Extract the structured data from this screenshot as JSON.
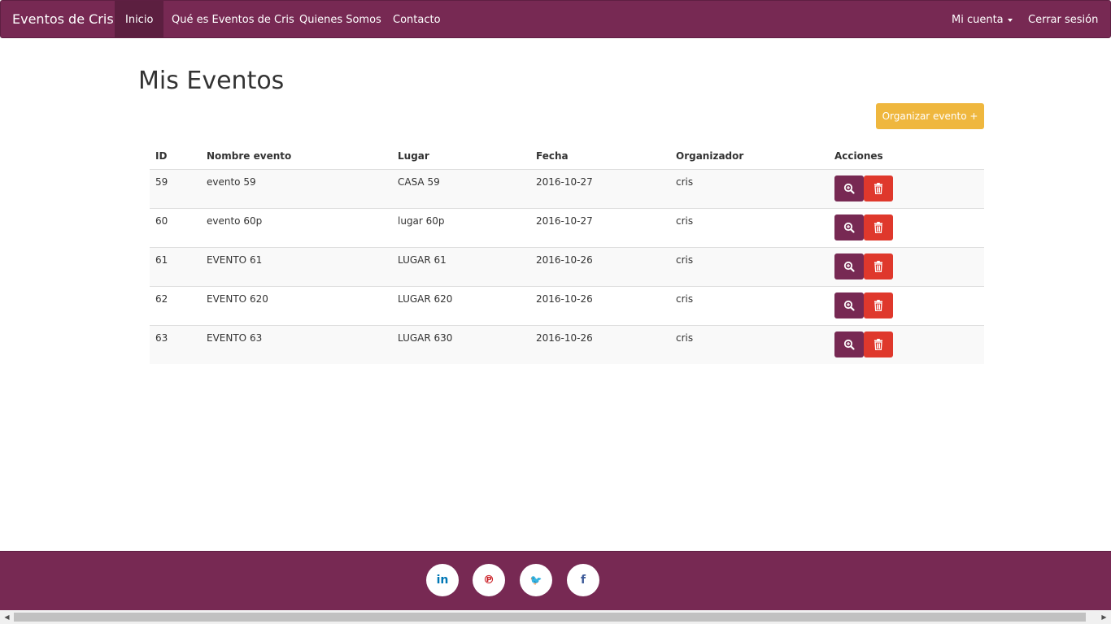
{
  "navbar": {
    "brand": "Eventos de Cris",
    "items": [
      {
        "label": "Inicio",
        "active": true
      },
      {
        "label": "Qué es Eventos de Cris"
      },
      {
        "label": "Quienes Somos"
      },
      {
        "label": "Contacto"
      }
    ],
    "account_label": "Mi cuenta",
    "logout_label": "Cerrar sesión"
  },
  "page": {
    "title": "Mis Eventos",
    "organize_button": "Organizar evento +"
  },
  "table": {
    "headers": [
      "ID",
      "Nombre evento",
      "Lugar",
      "Fecha",
      "Organizador",
      "Acciones"
    ],
    "rows": [
      {
        "id": "59",
        "name": "evento 59",
        "place": "CASA 59",
        "date": "2016-10-27",
        "organizer": "cris"
      },
      {
        "id": "60",
        "name": "evento 60p",
        "place": "lugar 60p",
        "date": "2016-10-27",
        "organizer": "cris"
      },
      {
        "id": "61",
        "name": "EVENTO 61",
        "place": "LUGAR 61",
        "date": "2016-10-26",
        "organizer": "cris"
      },
      {
        "id": "62",
        "name": "EVENTO 620",
        "place": "LUGAR 620",
        "date": "2016-10-26",
        "organizer": "cris"
      },
      {
        "id": "63",
        "name": "EVENTO 63",
        "place": "LUGAR 630",
        "date": "2016-10-26",
        "organizer": "cris"
      }
    ]
  },
  "footer": {
    "social": [
      {
        "icon": "linkedin-icon",
        "glyph": "in",
        "color": "#0077b5"
      },
      {
        "icon": "pinterest-icon",
        "glyph": "℗",
        "color": "#cb2027"
      },
      {
        "icon": "twitter-icon",
        "glyph": "🐦",
        "color": "#1da1f2"
      },
      {
        "icon": "facebook-icon",
        "glyph": "f",
        "color": "#3b5998"
      }
    ]
  },
  "colors": {
    "brand": "#772953",
    "warning": "#efb73e",
    "danger": "#df382c"
  }
}
